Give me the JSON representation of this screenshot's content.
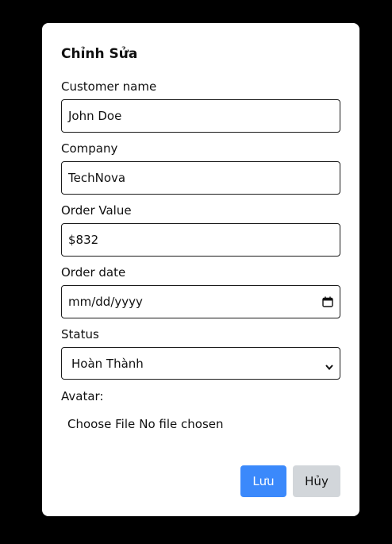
{
  "modal": {
    "title": "Chỉnh Sửa",
    "fields": {
      "customer_name": {
        "label": "Customer name",
        "value": "John Doe"
      },
      "company": {
        "label": "Company",
        "value": "TechNova"
      },
      "order_value": {
        "label": "Order Value",
        "value": "$832"
      },
      "order_date": {
        "label": "Order date",
        "placeholder": "mm/dd/yyyy"
      },
      "status": {
        "label": "Status",
        "value": "Hoàn Thành"
      },
      "avatar": {
        "label": "Avatar:",
        "button_label": "Choose File",
        "status_text": "No file chosen"
      }
    },
    "buttons": {
      "save_label": "Lưu",
      "cancel_label": "Hủy"
    },
    "colors": {
      "backdrop": "#000000",
      "save_button": "#3b89fb",
      "cancel_button": "#d2d6da"
    },
    "icons": {
      "date_picker": "calendar-icon",
      "status_select": "chevron-down-icon"
    }
  }
}
